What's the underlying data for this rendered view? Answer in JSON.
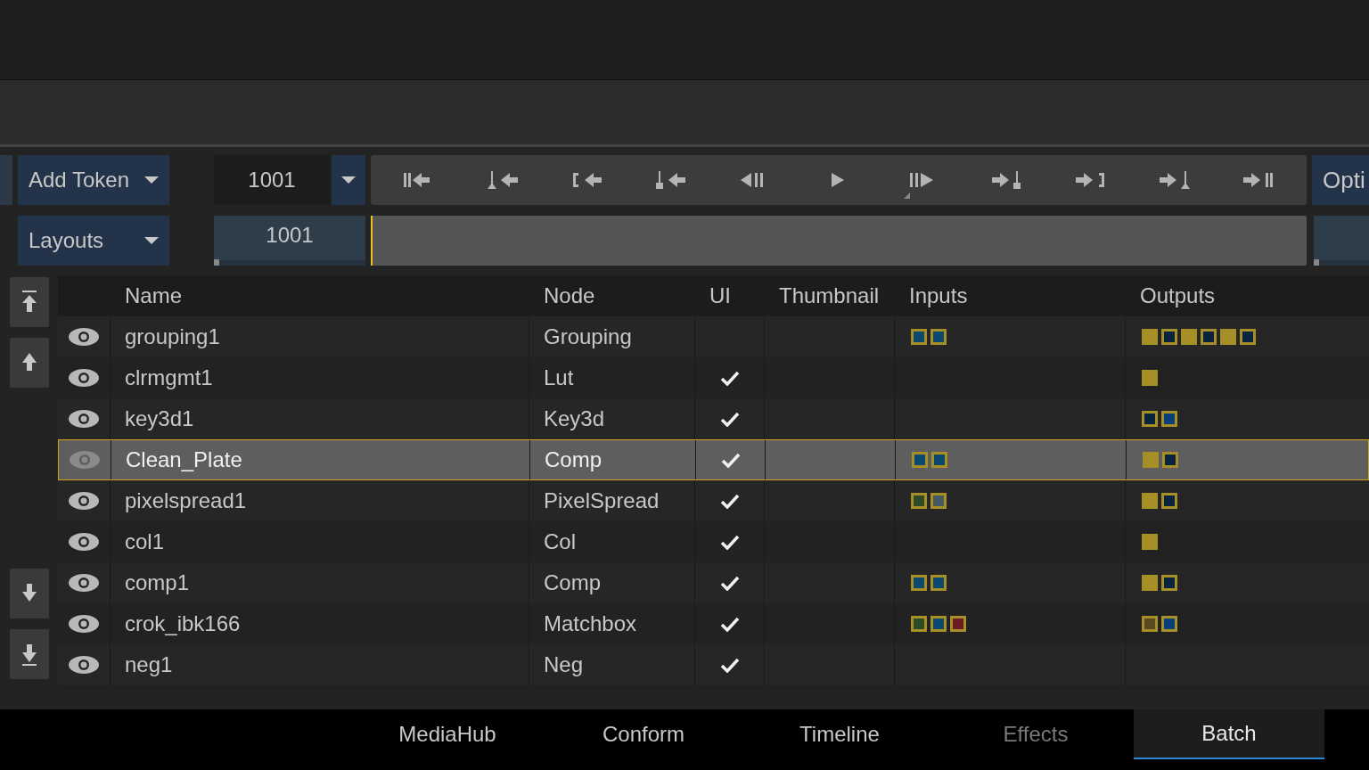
{
  "toolbar": {
    "add_token": "Add Token",
    "layouts": "Layouts",
    "frame_field": "1001",
    "current_frame": "1001",
    "options": "Opti",
    "scrubber": {
      "level": 0
    }
  },
  "table": {
    "columns": [
      "Name",
      "Node",
      "UI",
      "Thumbnail",
      "Inputs",
      "Outputs"
    ],
    "rows": [
      {
        "name": "grouping1",
        "node": "Grouping",
        "visible": true,
        "ui": false,
        "selected": false,
        "inputs": [
          {
            "color": "#0b4a6e"
          },
          {
            "color": "#0b4a6e"
          }
        ],
        "outputs": [
          {
            "color": "#a68f27"
          },
          {
            "color": "#0a2440"
          },
          {
            "color": "#a68f27"
          },
          {
            "color": "#0a2440"
          },
          {
            "color": "#a68f27"
          },
          {
            "color": "#0a2440"
          }
        ]
      },
      {
        "name": "clrmgmt1",
        "node": "Lut",
        "visible": true,
        "ui": true,
        "selected": false,
        "inputs": [],
        "outputs": [
          {
            "color": "#a68f27"
          }
        ]
      },
      {
        "name": "key3d1",
        "node": "Key3d",
        "visible": true,
        "ui": true,
        "selected": false,
        "inputs": [],
        "outputs": [
          {
            "color": "#0a2440"
          },
          {
            "color": "#0a3f78"
          }
        ]
      },
      {
        "name": "Clean_Plate",
        "node": "Comp",
        "visible": true,
        "ui": true,
        "selected": true,
        "inputs": [
          {
            "color": "#0b4a6e"
          },
          {
            "color": "#0b4a6e"
          }
        ],
        "outputs": [
          {
            "color": "#a68f27"
          },
          {
            "color": "#0a2440"
          }
        ]
      },
      {
        "name": "pixelspread1",
        "node": "PixelSpread",
        "visible": true,
        "ui": true,
        "selected": false,
        "inputs": [
          {
            "color": "#2e4a28"
          },
          {
            "color": "#465a66"
          }
        ],
        "outputs": [
          {
            "color": "#a68f27"
          },
          {
            "color": "#0a2440"
          }
        ]
      },
      {
        "name": "col1",
        "node": "Col",
        "visible": true,
        "ui": true,
        "selected": false,
        "inputs": [],
        "outputs": [
          {
            "color": "#a68f27"
          }
        ]
      },
      {
        "name": "comp1",
        "node": "Comp",
        "visible": true,
        "ui": true,
        "selected": false,
        "inputs": [
          {
            "color": "#0b4a6e"
          },
          {
            "color": "#0b4a6e"
          }
        ],
        "outputs": [
          {
            "color": "#a68f27"
          },
          {
            "color": "#0a2440"
          }
        ]
      },
      {
        "name": "crok_ibk166",
        "node": "Matchbox",
        "visible": true,
        "ui": true,
        "selected": false,
        "inputs": [
          {
            "color": "#2e4a28"
          },
          {
            "color": "#0b4a6e"
          },
          {
            "color": "#6a1c20"
          }
        ],
        "outputs": [
          {
            "color": "#5a4a20"
          },
          {
            "color": "#0a3f78"
          }
        ]
      },
      {
        "name": "neg1",
        "node": "Neg",
        "visible": true,
        "ui": true,
        "selected": false,
        "inputs": [],
        "outputs": []
      }
    ]
  },
  "tabs": [
    {
      "label": "MediaHub",
      "selected": false,
      "disabled": false
    },
    {
      "label": "Conform",
      "selected": false,
      "disabled": false
    },
    {
      "label": "Timeline",
      "selected": false,
      "disabled": false
    },
    {
      "label": "Effects",
      "selected": false,
      "disabled": true
    },
    {
      "label": "Batch",
      "selected": true,
      "disabled": false
    }
  ]
}
